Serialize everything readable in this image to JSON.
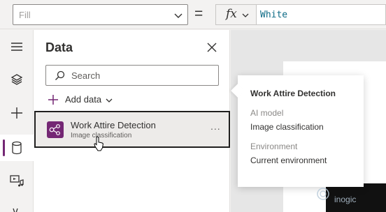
{
  "formula_bar": {
    "property": "Fill",
    "equals": "=",
    "fx_label": "fx",
    "formula": "White"
  },
  "rail": {
    "items": [
      "hamburger-icon",
      "layers-icon",
      "plus-icon",
      "database-icon",
      "media-icon",
      "variables-icon"
    ],
    "active": "database-icon"
  },
  "data_pane": {
    "title": "Data",
    "search_placeholder": "Search",
    "add_data_label": "Add data",
    "sources": [
      {
        "name": "Work Attire Detection",
        "type": "Image classification"
      }
    ],
    "more_label": "..."
  },
  "callout": {
    "title": "Work Attire Detection",
    "fields": [
      {
        "label": "AI model",
        "value": "Image classification"
      },
      {
        "label": "Environment",
        "value": "Current environment"
      }
    ]
  },
  "watermark": {
    "text": "inogic"
  },
  "colors": {
    "accent": "#742774",
    "formula_text": "#0b6a85",
    "rail_bg": "#f3f2f1",
    "selected_bg": "#edebe9"
  }
}
